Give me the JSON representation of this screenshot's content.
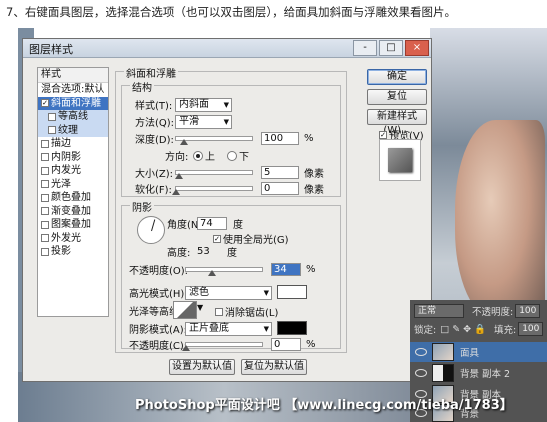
{
  "caption": "7、右键面具图层，选择混合选项（也可以双击图层），给面具加斜面与浮雕效果看图片。",
  "watermark": "PhotoShop平面设计吧 【www.linecg.com/tieba/1783】",
  "dialog": {
    "title": "图层样式",
    "window_buttons": [
      "-",
      "□",
      "×"
    ],
    "styles_panel": {
      "header": "样式",
      "items": [
        {
          "label": "混合选项:默认",
          "checkbox": false,
          "checked": false,
          "selected": false,
          "sub": false
        },
        {
          "label": "斜面和浮雕",
          "checkbox": true,
          "checked": true,
          "selected": true,
          "sub": false
        },
        {
          "label": "等高线",
          "checkbox": true,
          "checked": false,
          "selected": false,
          "sub": true
        },
        {
          "label": "纹理",
          "checkbox": true,
          "checked": false,
          "selected": false,
          "sub": true
        },
        {
          "label": "描边",
          "checkbox": true,
          "checked": false,
          "selected": false,
          "sub": false
        },
        {
          "label": "内阴影",
          "checkbox": true,
          "checked": false,
          "selected": false,
          "sub": false
        },
        {
          "label": "内发光",
          "checkbox": true,
          "checked": false,
          "selected": false,
          "sub": false
        },
        {
          "label": "光泽",
          "checkbox": true,
          "checked": false,
          "selected": false,
          "sub": false
        },
        {
          "label": "颜色叠加",
          "checkbox": true,
          "checked": false,
          "selected": false,
          "sub": false
        },
        {
          "label": "渐变叠加",
          "checkbox": true,
          "checked": false,
          "selected": false,
          "sub": false
        },
        {
          "label": "图案叠加",
          "checkbox": true,
          "checked": false,
          "selected": false,
          "sub": false
        },
        {
          "label": "外发光",
          "checkbox": true,
          "checked": false,
          "selected": false,
          "sub": false
        },
        {
          "label": "投影",
          "checkbox": true,
          "checked": false,
          "selected": false,
          "sub": false
        }
      ]
    },
    "bevel_group_title": "斜面和浮雕",
    "structure": {
      "title": "结构",
      "style_label": "样式(T):",
      "style_value": "内斜面",
      "method_label": "方法(Q):",
      "method_value": "平滑",
      "depth_label": "深度(D):",
      "depth_value": "100",
      "depth_unit": "%",
      "depth_level": 0.1,
      "direction_label": "方向:",
      "direction_up": "上",
      "direction_down": "下",
      "size_label": "大小(Z):",
      "size_value": "5",
      "size_unit": "像素",
      "size_level": 0.04,
      "soften_label": "软化(F):",
      "soften_value": "0",
      "soften_unit": "像素",
      "soften_level": 0.0
    },
    "shading": {
      "title": "阴影",
      "angle_label": "角度(N):",
      "angle_value": "74",
      "angle_unit": "度",
      "global_light_label": "使用全局光(G)",
      "global_light_checked": true,
      "altitude_label": "高度:",
      "altitude_value": "53",
      "altitude_unit": "度",
      "gloss_label": "光泽等高线:",
      "antialias_label": "消除锯齿(L)",
      "highlight_mode_label": "高光模式(H):",
      "highlight_mode_value": "滤色",
      "highlight_color": "#ffffff",
      "highlight_opacity_label": "不透明度(O):",
      "highlight_opacity_value": "34",
      "highlight_opacity_unit": "%",
      "highlight_opacity_level": 0.34,
      "shadow_mode_label": "阴影模式(A):",
      "shadow_mode_value": "正片叠底",
      "shadow_color": "#000000",
      "shadow_opacity_label": "不透明度(C):",
      "shadow_opacity_value": "0",
      "shadow_opacity_unit": "%",
      "shadow_opacity_level": 0.0
    },
    "make_default": "设置为默认值",
    "reset_default": "复位为默认值",
    "buttons": {
      "ok": "确定",
      "reset": "复位",
      "new_style": "新建样式(W)...",
      "preview": "预览(V)"
    }
  },
  "layers_panel": {
    "blend_mode": "正常",
    "opacity_label": "不透明度:",
    "opacity_value": "100",
    "lock_label": "锁定:",
    "fill_label": "填充:",
    "fill_value": "100",
    "layers": [
      {
        "name": "面具",
        "selected": true
      },
      {
        "name": "背景 副本 2",
        "selected": false
      },
      {
        "name": "背景 副本",
        "selected": false
      },
      {
        "name": "背景",
        "selected": false
      }
    ]
  }
}
